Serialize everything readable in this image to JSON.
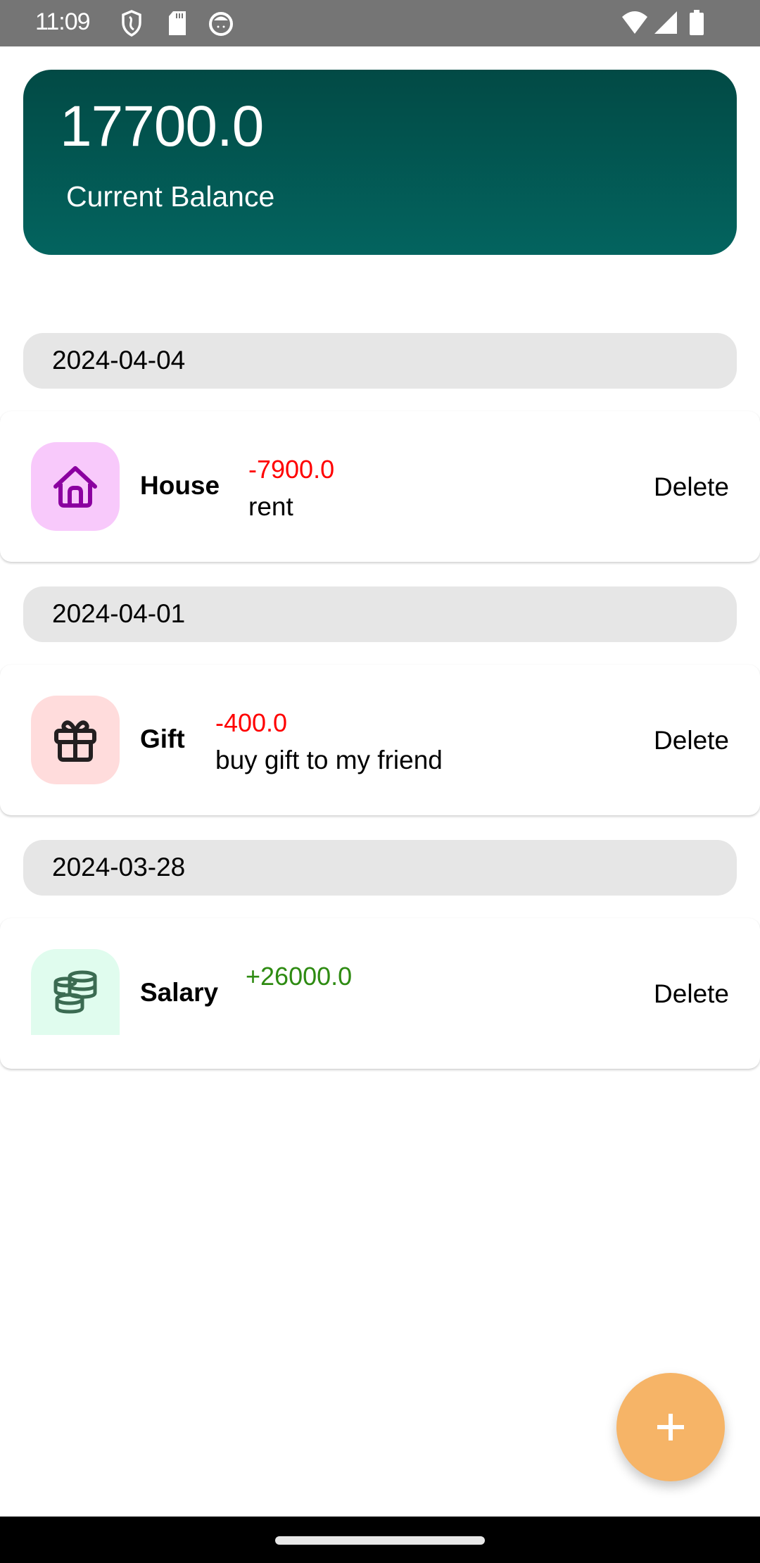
{
  "status_bar": {
    "time": "11:09",
    "left_icons": [
      "shield-icon",
      "sd-card-icon",
      "cat-face-icon"
    ],
    "right_icons": [
      "wifi-icon",
      "signal-icon",
      "battery-icon"
    ]
  },
  "balance": {
    "amount": "17700.0",
    "label": "Current Balance",
    "gradient_top": "#024a45",
    "gradient_bottom": "#03645f"
  },
  "groups": [
    {
      "date": "2024-04-04",
      "transactions": [
        {
          "category": "House",
          "icon": "house-icon",
          "icon_bg": "#f8c9fb",
          "icon_color": "#8b00a0",
          "amount": "-7900.0",
          "amount_color": "#ff0000",
          "note": "rent",
          "action": "Delete"
        }
      ]
    },
    {
      "date": "2024-04-01",
      "transactions": [
        {
          "category": "Gift",
          "icon": "gift-icon",
          "icon_bg": "#ffdcdc",
          "icon_color": "#231f20",
          "amount": "-400.0",
          "amount_color": "#ff0000",
          "note": "buy gift to my friend",
          "action": "Delete"
        }
      ]
    },
    {
      "date": "2024-03-28",
      "transactions": [
        {
          "category": "Salary",
          "icon": "coins-icon",
          "icon_bg": "#e0fcee",
          "icon_color": "#3b6b52",
          "amount": "+26000.0",
          "amount_color": "#2e8b12",
          "note": "",
          "action": "Delete"
        }
      ]
    }
  ],
  "fab": {
    "icon": "plus-icon",
    "color": "#f6b467"
  }
}
